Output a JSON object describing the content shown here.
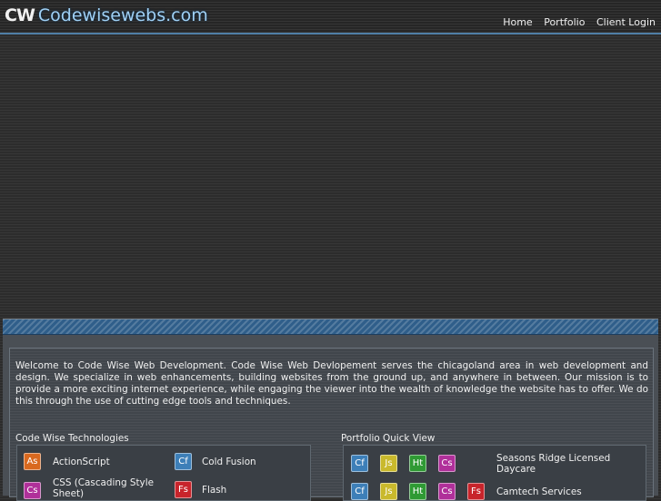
{
  "header": {
    "logo_mark": "CW",
    "logo_text": "Codewisewebs.com",
    "nav": [
      "Home",
      "Portfolio",
      "Client Login"
    ]
  },
  "welcome": "Welcome to Code Wise Web Development. Code Wise Web Devlopement serves the chicagoland area in web development and design. We specialize in web enhancements, building websites from the ground up, and anywhere in between. Our mission is to provide a more exciting internet experience, while engaging the viewer into the wealth of knowledge the website has to offer. We do this through the use of cutting edge tools and techniques.",
  "technologies": {
    "title": "Code Wise Technologies",
    "items": [
      {
        "icon": "As",
        "label": "ActionScript",
        "color": "#d9691f"
      },
      {
        "icon": "Cf",
        "label": "Cold Fusion",
        "color": "#3d7fb8"
      },
      {
        "icon": "Cs",
        "label": "CSS (Cascading Style Sheet)",
        "color": "#b0309a"
      },
      {
        "icon": "Fs",
        "label": "Flash",
        "color": "#c8242b"
      }
    ]
  },
  "portfolio": {
    "title": "Portfolio Quick View",
    "rows": [
      {
        "icons": [
          {
            "t": "Cf",
            "color": "#3d7fb8"
          },
          {
            "t": "Js",
            "color": "#c9b92c"
          },
          {
            "t": "Ht",
            "color": "#2f9a34"
          },
          {
            "t": "Cs",
            "color": "#b0309a"
          }
        ],
        "label": "Seasons Ridge Licensed Daycare"
      },
      {
        "icons": [
          {
            "t": "Cf",
            "color": "#3d7fb8"
          },
          {
            "t": "Js",
            "color": "#c9b92c"
          },
          {
            "t": "Ht",
            "color": "#2f9a34"
          },
          {
            "t": "Cs",
            "color": "#b0309a"
          },
          {
            "t": "Fs",
            "color": "#c8242b"
          }
        ],
        "label": "Camtech Services"
      }
    ]
  }
}
